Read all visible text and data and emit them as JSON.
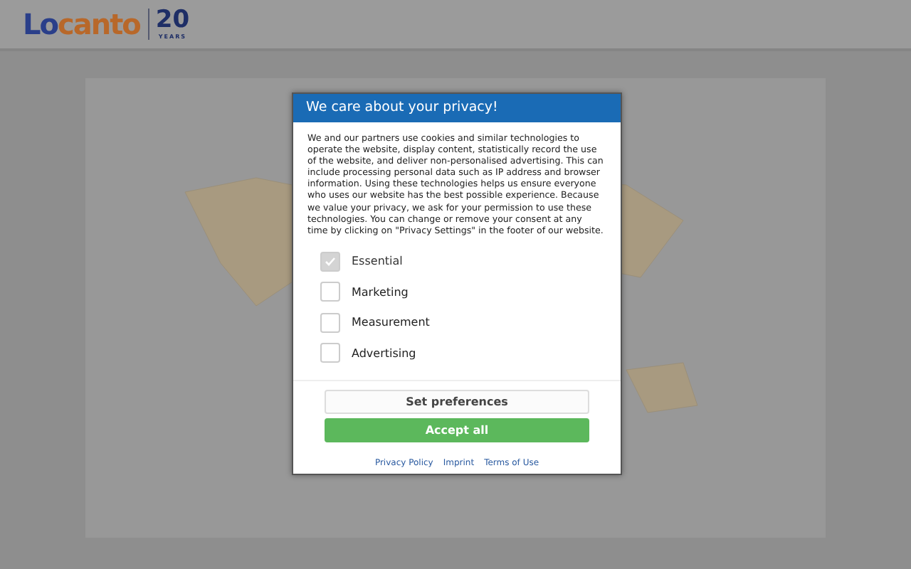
{
  "header": {
    "logo": {
      "part_1": "Lo",
      "part_2": "canto",
      "badge_number": "20",
      "badge_caption": "YEARS"
    }
  },
  "dialog": {
    "title": "We care about your privacy!",
    "body": "We and our partners use cookies and similar technologies to operate the website, display content, statistically record the use of the website, and deliver non-personalised advertising. This can include processing personal data such as IP address and browser information. Using these technologies helps us ensure everyone who uses our website has the best possible experience. Because we value your privacy, we ask for your permission to use these technologies. You can change or remove your consent at any time by clicking on \"Privacy Settings\" in the footer of our website.",
    "options": [
      {
        "label": "Essential",
        "checked": true,
        "disabled": true
      },
      {
        "label": "Marketing",
        "checked": false,
        "disabled": false
      },
      {
        "label": "Measurement",
        "checked": false,
        "disabled": false
      },
      {
        "label": "Advertising",
        "checked": false,
        "disabled": false
      }
    ],
    "buttons": [
      {
        "label": "Set preferences",
        "kind": "secondary"
      },
      {
        "label": "Accept all",
        "kind": "primary"
      }
    ],
    "links": [
      "Privacy Policy",
      "Imprint",
      "Terms of Use"
    ]
  }
}
